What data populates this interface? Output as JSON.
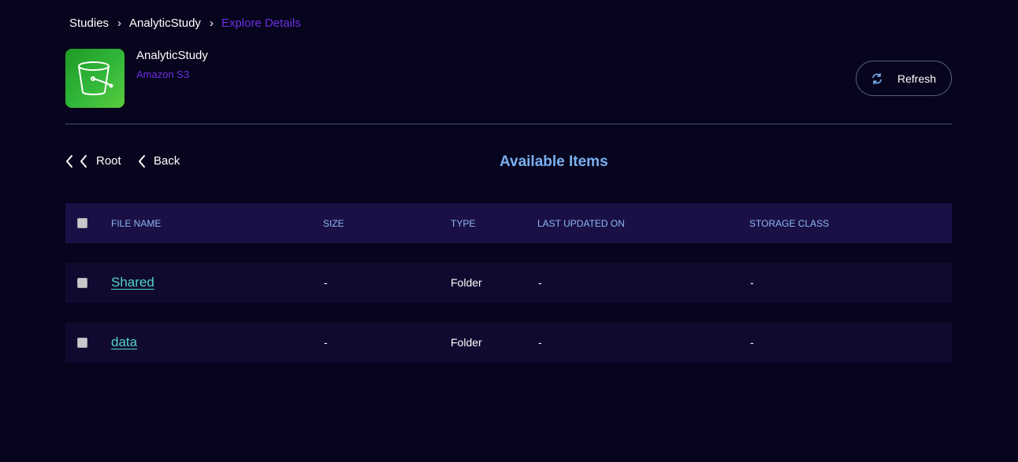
{
  "breadcrumb": {
    "items": [
      {
        "label": "Studies"
      },
      {
        "label": "AnalyticStudy"
      },
      {
        "label": "Explore Details"
      }
    ],
    "separator": "›"
  },
  "header": {
    "title": "AnalyticStudy",
    "subtitle": "Amazon S3",
    "icon": "s3-bucket-icon",
    "refresh_label": "Refresh"
  },
  "navigation": {
    "root_label": "Root",
    "back_label": "Back"
  },
  "section": {
    "title": "Available Items"
  },
  "table": {
    "columns": [
      "FILE NAME",
      "SIZE",
      "TYPE",
      "LAST UPDATED ON",
      "STORAGE CLASS"
    ],
    "rows": [
      {
        "name": "Shared",
        "size": "-",
        "type": "Folder",
        "updated": "-",
        "storage": "-"
      },
      {
        "name": "data",
        "size": "-",
        "type": "Folder",
        "updated": "-",
        "storage": "-"
      }
    ]
  },
  "colors": {
    "background": "#07051d",
    "accent_purple": "#6a2ee0",
    "title_blue": "#7ab0f0",
    "link_teal": "#4fd6c4",
    "table_header_bg": "#1a1045",
    "row_bg": "#110a30",
    "icon_green": "#32b83a"
  }
}
